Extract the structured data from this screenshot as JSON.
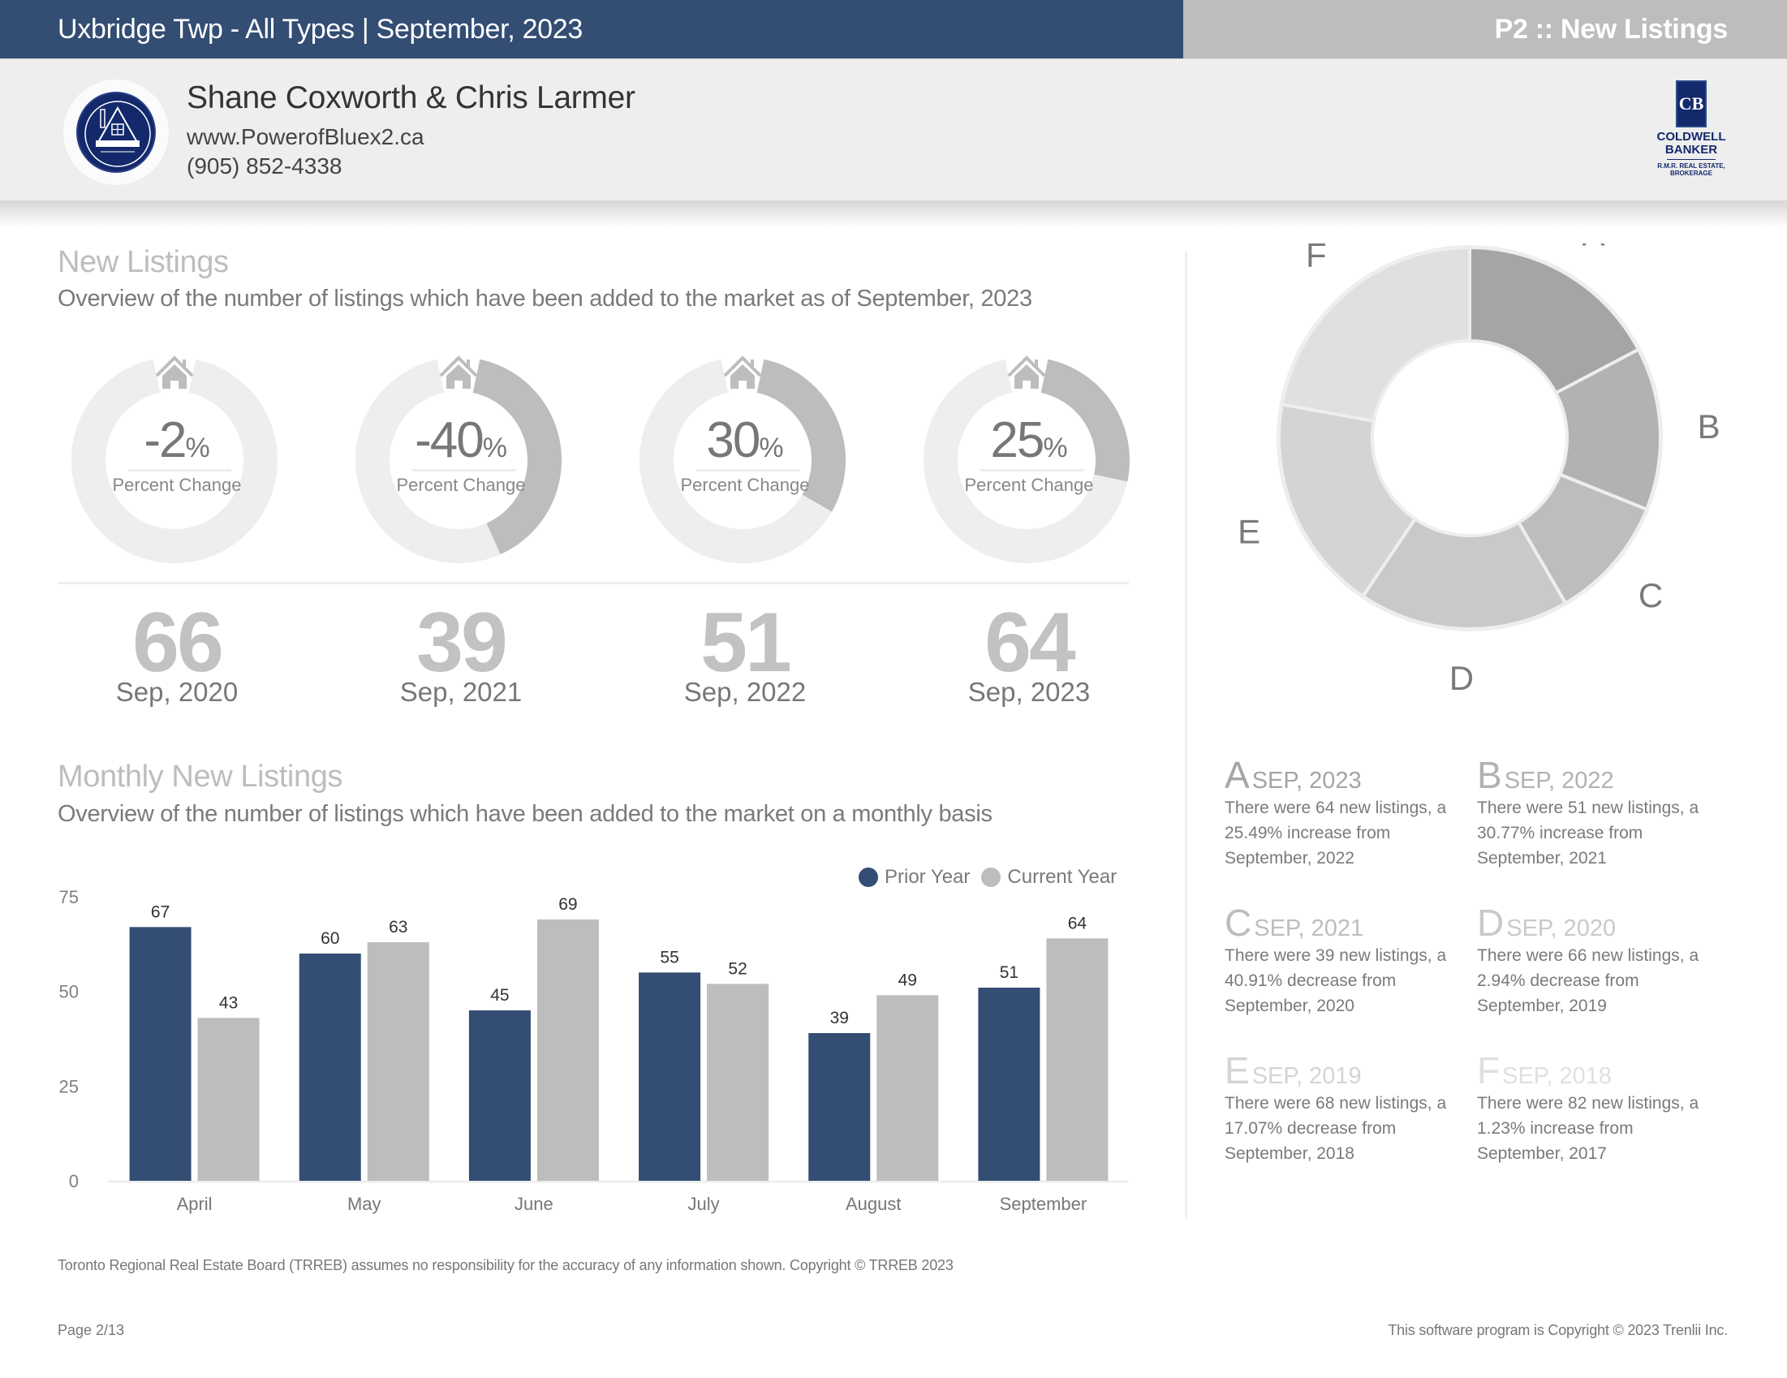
{
  "header": {
    "title": "Uxbridge Twp - All Types | September, 2023",
    "page_label": "P2 :: New Listings"
  },
  "agent": {
    "name": "Shane Coxworth & Chris Larmer",
    "website": "www.PowerofBluex2.ca",
    "phone": "(905) 852-4338",
    "logo_icon": "power-of-blue-logo-icon"
  },
  "brand": {
    "monogram": "CB",
    "line1": "COLDWELL",
    "line2": "BANKER",
    "line3": "R.M.R. REAL ESTATE,",
    "line4": "BROKERAGE",
    "color": "#13296b"
  },
  "colors": {
    "primary": "#334d73",
    "secondary": "#bdbdbd",
    "track": "#eeeeee"
  },
  "new_listings": {
    "title": "New Listings",
    "subtitle": "Overview of the number of listings which have been added to the market as of September, 2023",
    "gauge_label": "Percent Change",
    "percent_unit": "%",
    "gauges": [
      {
        "percent": "-2",
        "fill_fraction": 0.02,
        "count": "66",
        "date": "Sep, 2020"
      },
      {
        "percent": "-40",
        "fill_fraction": 0.4,
        "count": "39",
        "date": "Sep, 2021"
      },
      {
        "percent": "30",
        "fill_fraction": 0.3,
        "count": "51",
        "date": "Sep, 2022"
      },
      {
        "percent": "25",
        "fill_fraction": 0.25,
        "count": "64",
        "date": "Sep, 2023"
      }
    ]
  },
  "monthly": {
    "title": "Monthly New Listings",
    "subtitle": "Overview of the number of listings which have been added to the market on a monthly basis"
  },
  "chart_data": [
    {
      "type": "bar",
      "title": "Monthly New Listings",
      "xlabel": "",
      "ylabel": "",
      "categories": [
        "April",
        "May",
        "June",
        "July",
        "August",
        "September"
      ],
      "series": [
        {
          "name": "Prior Year",
          "color": "#334d73",
          "values": [
            67,
            60,
            45,
            55,
            39,
            51
          ]
        },
        {
          "name": "Current Year",
          "color": "#bdbdbd",
          "values": [
            43,
            63,
            69,
            52,
            49,
            64
          ]
        }
      ],
      "ylim": [
        0,
        75
      ],
      "yticks": [
        0,
        25,
        50,
        75
      ],
      "grid": false,
      "legend": "top-right",
      "data_labels": true
    },
    {
      "type": "pie",
      "donut": true,
      "title": "",
      "labels": [
        "A",
        "B",
        "C",
        "D",
        "E",
        "F"
      ],
      "values": [
        64,
        51,
        39,
        66,
        68,
        82
      ],
      "colors": [
        "#a5a5a5",
        "#b2b2b2",
        "#bdbdbd",
        "#c9c9c9",
        "#d4d4d4",
        "#e0e0e0"
      ],
      "legend": "none"
    }
  ],
  "year_cards": [
    {
      "letter": "A",
      "date": "SEP, 2023",
      "text": "There were 64 new listings, a 25.49% increase from September, 2022",
      "color": "#a5a5a5"
    },
    {
      "letter": "B",
      "date": "SEP, 2022",
      "text": "There were 51 new listings, a 30.77% increase from September, 2021",
      "color": "#b2b2b2"
    },
    {
      "letter": "C",
      "date": "SEP, 2021",
      "text": "There were 39 new listings, a 40.91% decrease from September, 2020",
      "color": "#bdbdbd"
    },
    {
      "letter": "D",
      "date": "SEP, 2020",
      "text": "There were 66 new listings, a 2.94% decrease from September, 2019",
      "color": "#c9c9c9"
    },
    {
      "letter": "E",
      "date": "SEP, 2019",
      "text": "There were 68 new listings, a 17.07% decrease from September, 2018",
      "color": "#d4d4d4"
    },
    {
      "letter": "F",
      "date": "SEP, 2018",
      "text": "There were 82 new listings, a 1.23% increase from September, 2017",
      "color": "#e0e0e0"
    }
  ],
  "footer": {
    "disclaimer": "Toronto Regional Real Estate Board (TRREB) assumes no responsibility for the accuracy of any information shown. Copyright © TRREB 2023",
    "page": "Page 2/13",
    "copyright": "This software program is Copyright © 2023 Trenlii Inc."
  }
}
